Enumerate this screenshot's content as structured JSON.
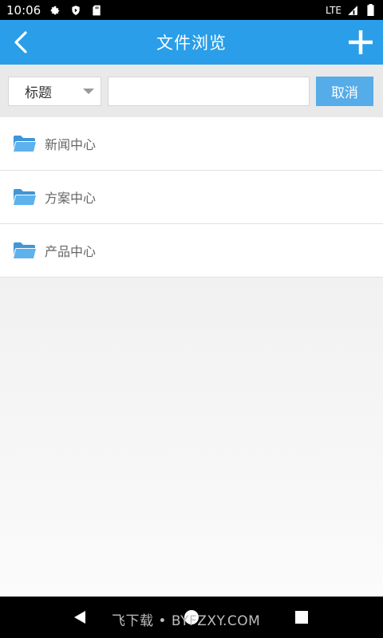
{
  "status_bar": {
    "time": "10:06",
    "network": "LTE"
  },
  "app_bar": {
    "title": "文件浏览"
  },
  "search": {
    "filter_selected": "标题",
    "input_value": "",
    "input_placeholder": "",
    "cancel_label": "取消"
  },
  "files": [
    {
      "name": "新闻中心",
      "icon": "folder-icon"
    },
    {
      "name": "方案中心",
      "icon": "folder-icon"
    },
    {
      "name": "产品中心",
      "icon": "folder-icon"
    }
  ],
  "watermark": {
    "text": "飞下载 • BYFZXY.COM"
  },
  "colors": {
    "primary": "#2a9ee8",
    "cancel_button": "#55ace8",
    "folder": "#4ea8e6"
  }
}
